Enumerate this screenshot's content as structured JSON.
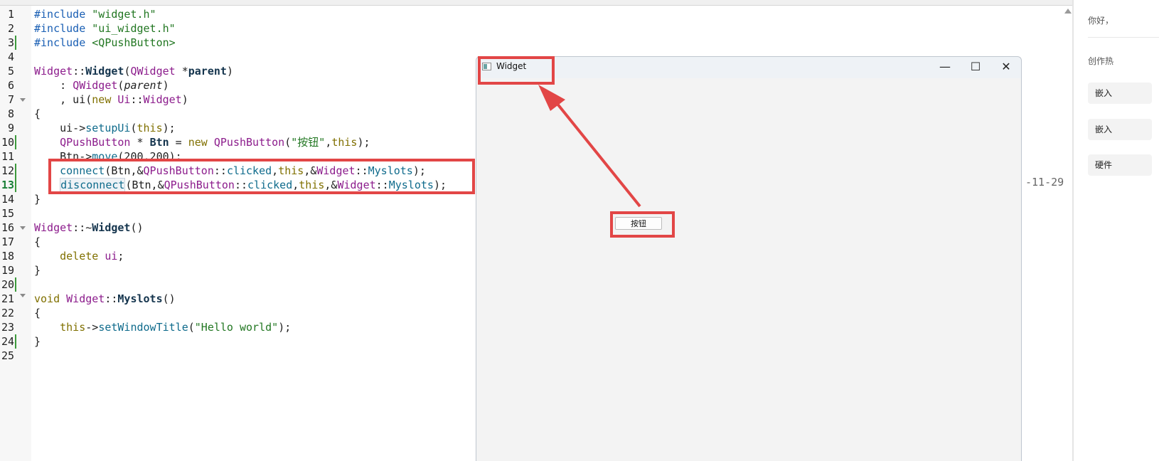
{
  "editor": {
    "line_numbers": [
      "1",
      "2",
      "3",
      "4",
      "5",
      "6",
      "7",
      "8",
      "9",
      "10",
      "11",
      "12",
      "13",
      "14",
      "15",
      "16",
      "17",
      "18",
      "19",
      "20",
      "21",
      "22",
      "23",
      "24",
      "25"
    ],
    "code": {
      "l1": {
        "kw": "#include",
        "s": " \"widget.h\""
      },
      "l2": {
        "kw": "#include",
        "s": " \"ui_widget.h\""
      },
      "l3": {
        "kw": "#include",
        "s": " <QPushButton>"
      },
      "l5": {
        "cls": "Widget",
        "sep": "::",
        "fn": "Widget",
        "p1": "(",
        "ty": "QWidget",
        "p2": " *",
        "arg": "parent",
        "p3": ")"
      },
      "l6": {
        "pre": "    : ",
        "ty": "QWidget",
        "p1": "(",
        "arg": "parent",
        "p2": ")"
      },
      "l7": {
        "pre": "    , ui(",
        "kw": "new",
        "p1": " ",
        "ty": "Ui",
        "sep": "::",
        "cls": "Widget",
        "p2": ")"
      },
      "l8": {
        "t": "{"
      },
      "l9": {
        "pre": "    ui->",
        "fn": "setupUi",
        "p1": "(",
        "kw": "this",
        "p2": ");"
      },
      "l10": {
        "pre": "    ",
        "ty": "QPushButton",
        "p1": " * ",
        "var": "Btn",
        "p2": " = ",
        "kw": "new",
        "p3": " ",
        "ty2": "QPushButton",
        "p4": "(",
        "s": "\"按钮\"",
        "p5": ",",
        "kw2": "this",
        "p6": ");"
      },
      "l11": {
        "pre": "    Btn->",
        "fn": "move",
        "p1": "(200,200);"
      },
      "l12": {
        "pre": "    ",
        "fn": "connect",
        "p1": "(Btn,&",
        "ty": "QPushButton",
        "sep": "::",
        "fn2": "clicked",
        "p2": ",",
        "kw": "this",
        "p3": ",&",
        "cls": "Widget",
        "sep2": "::",
        "fn3": "Myslots",
        "p4": ");"
      },
      "l13": {
        "pre": "    ",
        "fn": "disconnect",
        "p1": "(Btn,&",
        "ty": "QPushButton",
        "sep": "::",
        "fn2": "clicked",
        "p2": ",",
        "kw": "this",
        "p3": ",&",
        "cls": "Widget",
        "sep2": "::",
        "fn3": "Myslots",
        "p4": ");"
      },
      "l14": {
        "t": "}"
      },
      "l16": {
        "cls": "Widget",
        "sep": "::~",
        "fn": "Widget",
        "p1": "()"
      },
      "l17": {
        "t": "{"
      },
      "l18": {
        "pre": "    ",
        "kw": "delete",
        "p1": " ",
        "var": "ui",
        "p2": ";"
      },
      "l19": {
        "t": "}"
      },
      "l21": {
        "kw": "void",
        "p1": " ",
        "cls": "Widget",
        "sep": "::",
        "fn": "Myslots",
        "p2": "()"
      },
      "l22": {
        "t": "{"
      },
      "l23": {
        "pre": "    ",
        "kw": "this",
        "p1": "->",
        "fn": "setWindowTitle",
        "p2": "(",
        "s": "\"Hello world\"",
        "p3": ");"
      },
      "l24": {
        "t": "}"
      }
    },
    "annotation": "-11-29"
  },
  "widget_window": {
    "title": "Widget",
    "minimize": "—",
    "maximize": "☐",
    "close": "✕",
    "button_label": "按钮"
  },
  "right_panel": {
    "greeting": "你好，",
    "hot_label": "创作热",
    "btn1": "嵌入",
    "btn2": "嵌入",
    "btn3": "硬件"
  },
  "colors": {
    "highlight": "#e24646",
    "preprocessor": "#1a5fb4",
    "string": "#227722",
    "type": "#8c1c8c",
    "function": "#0f6b8c",
    "keyword": "#807000"
  }
}
